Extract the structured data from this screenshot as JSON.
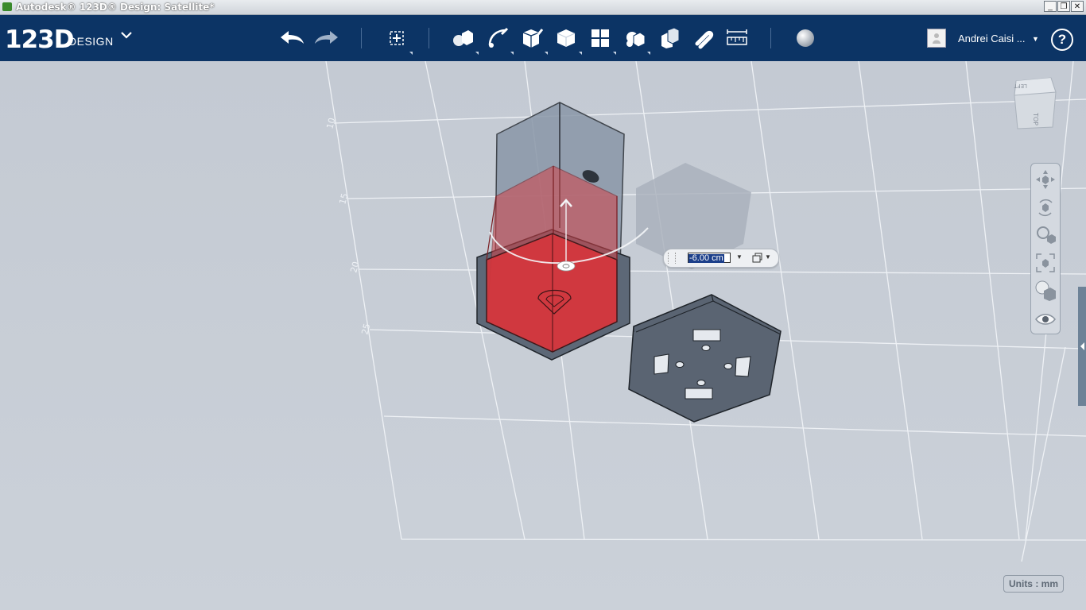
{
  "window": {
    "title": "Autodesk® 123D® Design: Satellite*",
    "controls": {
      "minimize": "_",
      "restore": "❐",
      "close": "✕"
    }
  },
  "brand": {
    "number": "123D",
    "word": "DESIGN",
    "menu_icon": "chevron-down-icon"
  },
  "toolbar": {
    "tools": [
      {
        "name": "undo",
        "icon": "undo-icon"
      },
      {
        "name": "redo",
        "icon": "redo-icon"
      },
      {
        "name": "transform",
        "icon": "transform-icon"
      },
      {
        "name": "primitives",
        "icon": "primitives-icon"
      },
      {
        "name": "sketch",
        "icon": "sketch-icon"
      },
      {
        "name": "construct",
        "icon": "construct-icon"
      },
      {
        "name": "modify",
        "icon": "modify-icon"
      },
      {
        "name": "pattern",
        "icon": "pattern-icon"
      },
      {
        "name": "grouping",
        "icon": "grouping-icon"
      },
      {
        "name": "combine",
        "icon": "combine-icon"
      },
      {
        "name": "snap",
        "icon": "snap-icon"
      },
      {
        "name": "measure",
        "icon": "measure-icon"
      },
      {
        "name": "material",
        "icon": "material-sphere-icon"
      }
    ]
  },
  "user": {
    "name": "Andrei Caisi ...",
    "avatar_icon": "user-avatar-icon",
    "help_label": "?"
  },
  "viewcube": {
    "faces": {
      "left": "LEFT",
      "top": "TOP"
    }
  },
  "grid_labels": [
    "10",
    "15",
    "20",
    "25"
  ],
  "dimension_input": {
    "value": "-6.00 cm"
  },
  "units": {
    "label": "Units : mm"
  },
  "colors": {
    "toolbar_bg": "#0c3465",
    "viewport_bg": "#c7cdd6",
    "selection_red": "#d23a3f",
    "body_gray": "#6b7a8b",
    "plate_gray": "#5b6573"
  }
}
